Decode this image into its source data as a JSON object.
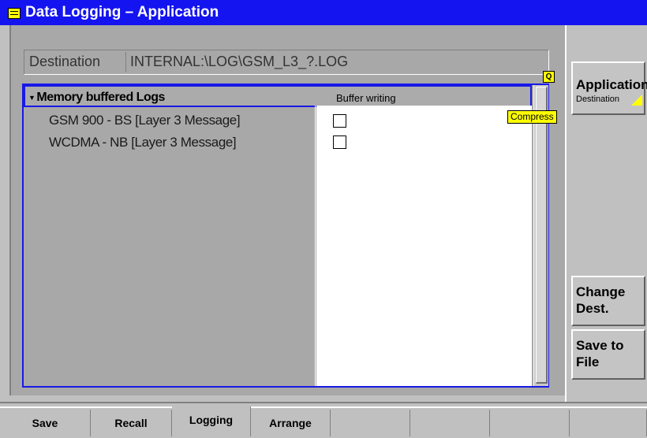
{
  "window": {
    "title": "Data Logging – Application"
  },
  "destination": {
    "label": "Destination",
    "value": "INTERNAL:\\LOG\\GSM_L3_?.LOG"
  },
  "indicators": {
    "q_icon": "Q",
    "compress_tag": "Compress"
  },
  "table": {
    "tree_header": "Memory buffered Logs",
    "buffer_header": "Buffer writing",
    "rows": [
      {
        "label": "GSM 900 - BS [Layer 3 Message]",
        "buffer_writing": false
      },
      {
        "label": "WCDMA - NB [Layer 3 Message]",
        "buffer_writing": false
      }
    ]
  },
  "softkeys": {
    "application": {
      "title": "Application",
      "subtitle": "Destination"
    },
    "change_dest": "Change\nDest.",
    "save_to_file": "Save to\nFile"
  },
  "tabs": [
    {
      "label": "Save",
      "active": false
    },
    {
      "label": "Recall",
      "active": false
    },
    {
      "label": "Logging",
      "active": true
    },
    {
      "label": "Arrange",
      "active": false
    },
    {
      "label": "",
      "active": false
    },
    {
      "label": "",
      "active": false
    },
    {
      "label": "",
      "active": false
    },
    {
      "label": "",
      "active": false
    }
  ],
  "colors": {
    "titlebar": "#1414f0",
    "highlight": "#1818e8",
    "accent_yellow": "#ffff00"
  }
}
